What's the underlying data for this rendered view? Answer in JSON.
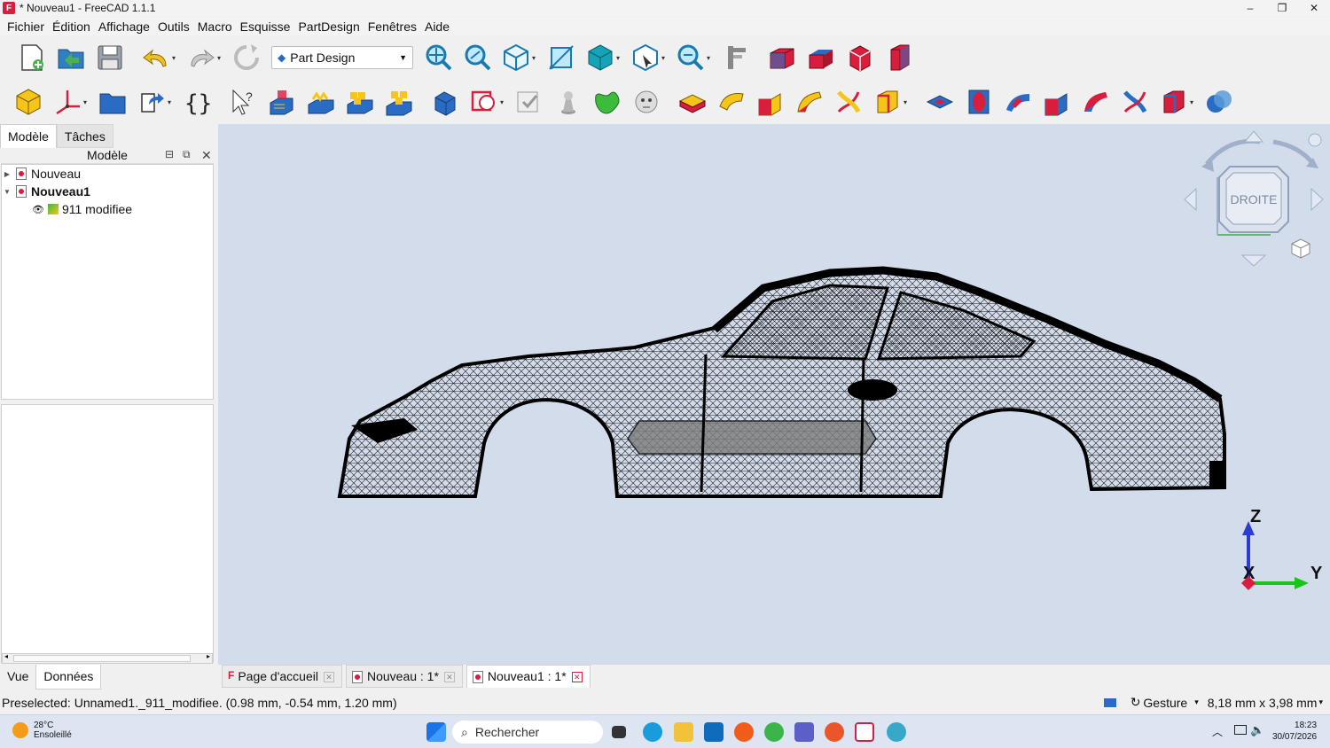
{
  "window": {
    "title": "* Nouveau1 - FreeCAD 1.1.1",
    "minimize": "–",
    "maximize": "❐",
    "close": "✕"
  },
  "menu": [
    "Fichier",
    "Édition",
    "Affichage",
    "Outils",
    "Macro",
    "Esquisse",
    "PartDesign",
    "Fenêtres",
    "Aide"
  ],
  "toolbar": {
    "workbench": "Part Design"
  },
  "left_panel": {
    "tabs": [
      "Modèle",
      "Tâches"
    ],
    "tree_header": "Modèle",
    "tree": [
      {
        "label": "Nouveau",
        "bold": false
      },
      {
        "label": "Nouveau1",
        "bold": true
      },
      {
        "label": "911 modifiee",
        "bold": false
      }
    ],
    "bottom_tabs": [
      "Vue",
      "Données"
    ]
  },
  "viewport": {
    "navcube_face": "DROITE",
    "axis_z": "Z",
    "axis_x": "X",
    "axis_y": "Y"
  },
  "doc_tabs": [
    "Page d'accueil",
    "Nouveau : 1*",
    "Nouveau1 : 1*"
  ],
  "statusbar": {
    "message": "Preselected: Unnamed1._911_modifiee. (0.98 mm, -0.54 mm, 1.20 mm)",
    "nav_style": "Gesture",
    "dimension": "8,18 mm x 3,98 mm"
  },
  "taskbar": {
    "weather_temp": "28°C",
    "weather_desc": "Ensoleillé",
    "search_placeholder": "Rechercher",
    "time": "18:23",
    "date": "30/07/2026"
  },
  "colors": {
    "viewport_bg": "#d3dceb",
    "accent_red": "#d81e3c",
    "accent_blue": "#2a6cc4"
  }
}
